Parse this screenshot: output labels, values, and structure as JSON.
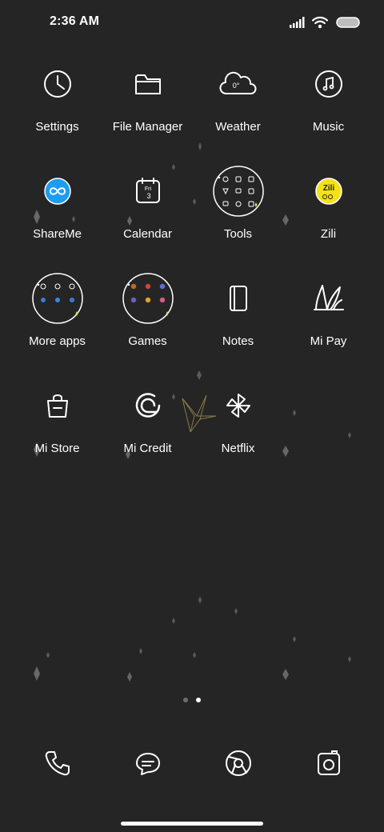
{
  "status_bar": {
    "time": "2:36 AM"
  },
  "apps": [
    {
      "label": "Settings",
      "icon": "clock-icon"
    },
    {
      "label": "File Manager",
      "icon": "folder-icon"
    },
    {
      "label": "Weather",
      "icon": "cloud-icon",
      "badge": "0°"
    },
    {
      "label": "Music",
      "icon": "music-note-icon"
    },
    {
      "label": "ShareMe",
      "icon": "shareme-icon",
      "color": "#1e9cf0"
    },
    {
      "label": "Calendar",
      "icon": "calendar-icon",
      "day": "Fri",
      "date": "3"
    },
    {
      "label": "Tools",
      "icon": "tools-folder-icon"
    },
    {
      "label": "Zili",
      "icon": "zili-icon",
      "badge": "Zili",
      "color": "#f4e11a"
    },
    {
      "label": "More apps",
      "icon": "more-apps-folder-icon"
    },
    {
      "label": "Games",
      "icon": "games-folder-icon"
    },
    {
      "label": "Notes",
      "icon": "notes-icon"
    },
    {
      "label": "Mi Pay",
      "icon": "mi-pay-icon"
    },
    {
      "label": "Mi Store",
      "icon": "shopping-bag-icon"
    },
    {
      "label": "Mi Credit",
      "icon": "mi-credit-icon"
    },
    {
      "label": "Netflix",
      "icon": "pinwheel-icon"
    }
  ],
  "page_indicator": {
    "pages": 2,
    "active": 2
  },
  "dock": [
    {
      "icon": "phone-icon"
    },
    {
      "icon": "messages-icon"
    },
    {
      "icon": "browser-icon"
    },
    {
      "icon": "camera-icon"
    }
  ]
}
